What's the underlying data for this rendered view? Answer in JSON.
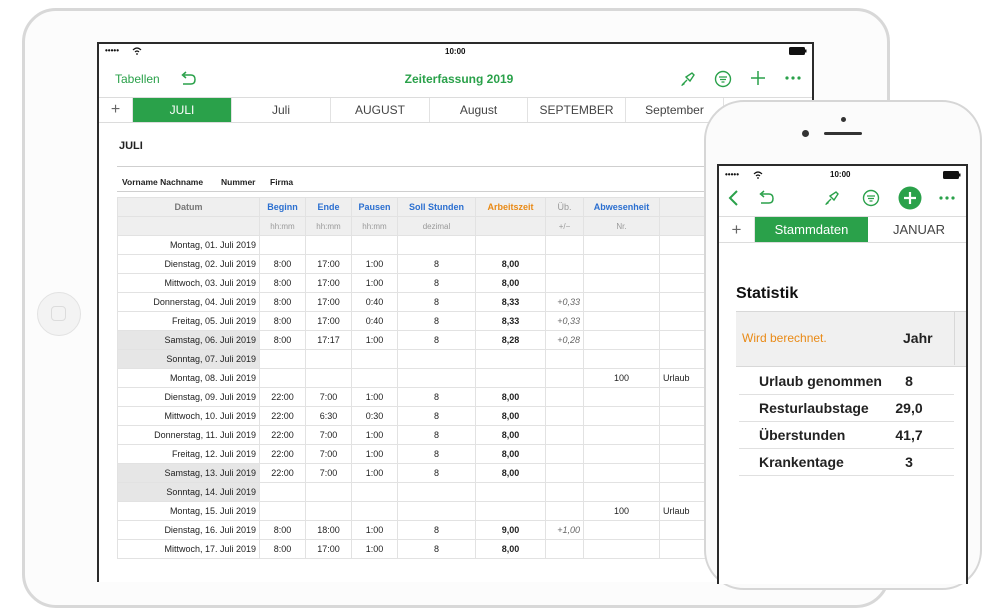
{
  "ipad": {
    "status": {
      "time": "10:00",
      "signal": "•••••"
    },
    "toolbar": {
      "back_label": "Tabellen",
      "title": "Zeiterfassung 2019"
    },
    "tabs": [
      {
        "label": "JULI",
        "active": true
      },
      {
        "label": "Juli",
        "active": false
      },
      {
        "label": "AUGUST",
        "active": false
      },
      {
        "label": "August",
        "active": false
      },
      {
        "label": "SEPTEMBER",
        "active": false
      },
      {
        "label": "September",
        "active": false
      }
    ],
    "sheet_title": "JULI",
    "info": {
      "name_label": "Vorname Nachname",
      "number_label": "Nummer",
      "company_label": "Firma"
    },
    "columns": {
      "datum": "Datum",
      "beginn": "Beginn",
      "beginn_unit": "hh:mm",
      "ende": "Ende",
      "ende_unit": "hh:mm",
      "pausen": "Pausen",
      "pausen_unit": "hh:mm",
      "soll": "Soll Stunden",
      "soll_unit": "dezimal",
      "arbeitszeit": "Arbeitszeit",
      "ueb": "Üb.",
      "ueb_unit": "+/−",
      "abwesenheit": "Abwesenheit",
      "abwesenheit_unit": "Nr."
    },
    "rows": [
      {
        "date": "Montag, 01. Juli 2019",
        "beginn": "",
        "ende": "",
        "pausen": "",
        "soll": "",
        "arbeit": "",
        "ueb": "",
        "abw": "",
        "grund": "",
        "weekend": false
      },
      {
        "date": "Dienstag, 02. Juli 2019",
        "beginn": "8:00",
        "ende": "17:00",
        "pausen": "1:00",
        "soll": "8",
        "arbeit": "8,00",
        "ueb": "",
        "abw": "",
        "grund": "",
        "weekend": false
      },
      {
        "date": "Mittwoch, 03. Juli 2019",
        "beginn": "8:00",
        "ende": "17:00",
        "pausen": "1:00",
        "soll": "8",
        "arbeit": "8,00",
        "ueb": "",
        "abw": "",
        "grund": "",
        "weekend": false
      },
      {
        "date": "Donnerstag, 04. Juli 2019",
        "beginn": "8:00",
        "ende": "17:00",
        "pausen": "0:40",
        "soll": "8",
        "arbeit": "8,33",
        "ueb": "+0,33",
        "abw": "",
        "grund": "",
        "weekend": false
      },
      {
        "date": "Freitag, 05. Juli 2019",
        "beginn": "8:00",
        "ende": "17:00",
        "pausen": "0:40",
        "soll": "8",
        "arbeit": "8,33",
        "ueb": "+0,33",
        "abw": "",
        "grund": "",
        "weekend": false
      },
      {
        "date": "Samstag, 06. Juli 2019",
        "beginn": "8:00",
        "ende": "17:17",
        "pausen": "1:00",
        "soll": "8",
        "arbeit": "8,28",
        "ueb": "+0,28",
        "abw": "",
        "grund": "",
        "weekend": true
      },
      {
        "date": "Sonntag, 07. Juli 2019",
        "beginn": "",
        "ende": "",
        "pausen": "",
        "soll": "",
        "arbeit": "",
        "ueb": "",
        "abw": "",
        "grund": "",
        "weekend": true
      },
      {
        "date": "Montag, 08. Juli 2019",
        "beginn": "",
        "ende": "",
        "pausen": "",
        "soll": "",
        "arbeit": "",
        "ueb": "",
        "abw": "100",
        "grund": "Urlaub",
        "weekend": false
      },
      {
        "date": "Dienstag, 09. Juli 2019",
        "beginn": "22:00",
        "ende": "7:00",
        "pausen": "1:00",
        "soll": "8",
        "arbeit": "8,00",
        "ueb": "",
        "abw": "",
        "grund": "",
        "weekend": false
      },
      {
        "date": "Mittwoch, 10. Juli 2019",
        "beginn": "22:00",
        "ende": "6:30",
        "pausen": "0:30",
        "soll": "8",
        "arbeit": "8,00",
        "ueb": "",
        "abw": "",
        "grund": "",
        "weekend": false
      },
      {
        "date": "Donnerstag, 11. Juli 2019",
        "beginn": "22:00",
        "ende": "7:00",
        "pausen": "1:00",
        "soll": "8",
        "arbeit": "8,00",
        "ueb": "",
        "abw": "",
        "grund": "",
        "weekend": false
      },
      {
        "date": "Freitag, 12. Juli 2019",
        "beginn": "22:00",
        "ende": "7:00",
        "pausen": "1:00",
        "soll": "8",
        "arbeit": "8,00",
        "ueb": "",
        "abw": "",
        "grund": "",
        "weekend": false
      },
      {
        "date": "Samstag, 13. Juli 2019",
        "beginn": "22:00",
        "ende": "7:00",
        "pausen": "1:00",
        "soll": "8",
        "arbeit": "8,00",
        "ueb": "",
        "abw": "",
        "grund": "",
        "weekend": true
      },
      {
        "date": "Sonntag, 14. Juli 2019",
        "beginn": "",
        "ende": "",
        "pausen": "",
        "soll": "",
        "arbeit": "",
        "ueb": "",
        "abw": "",
        "grund": "",
        "weekend": true
      },
      {
        "date": "Montag, 15. Juli 2019",
        "beginn": "",
        "ende": "",
        "pausen": "",
        "soll": "",
        "arbeit": "",
        "ueb": "",
        "abw": "100",
        "grund": "Urlaub",
        "weekend": false
      },
      {
        "date": "Dienstag, 16. Juli 2019",
        "beginn": "8:00",
        "ende": "18:00",
        "pausen": "1:00",
        "soll": "8",
        "arbeit": "9,00",
        "ueb": "+1,00",
        "abw": "",
        "grund": "",
        "weekend": false
      },
      {
        "date": "Mittwoch, 17. Juli 2019",
        "beginn": "8:00",
        "ende": "17:00",
        "pausen": "1:00",
        "soll": "8",
        "arbeit": "8,00",
        "ueb": "",
        "abw": "",
        "grund": "",
        "weekend": false
      }
    ]
  },
  "iphone": {
    "status": {
      "time": "10:00",
      "signal": "•••••"
    },
    "tabs": [
      {
        "label": "Stammdaten",
        "active": true
      },
      {
        "label": "JANUAR",
        "active": false
      }
    ],
    "section_title": "Statistik",
    "header": {
      "computing": "Wird berechnet.",
      "year_label": "Jahr"
    },
    "stats": [
      {
        "label": "Urlaub genommen",
        "value": "8"
      },
      {
        "label": "Resturlaubstage",
        "value": "29,0"
      },
      {
        "label": "Überstunden",
        "value": "41,7"
      },
      {
        "label": "Krankentage",
        "value": "3"
      }
    ]
  },
  "colors": {
    "accent": "#2aa14a",
    "header_blue": "#2b6fd0",
    "header_orange": "#e98a16"
  },
  "icons": [
    "undo-icon",
    "brush-icon",
    "filter-icon",
    "plus-icon",
    "more-icon",
    "back-chevron-icon",
    "wifi-icon",
    "battery-icon"
  ]
}
